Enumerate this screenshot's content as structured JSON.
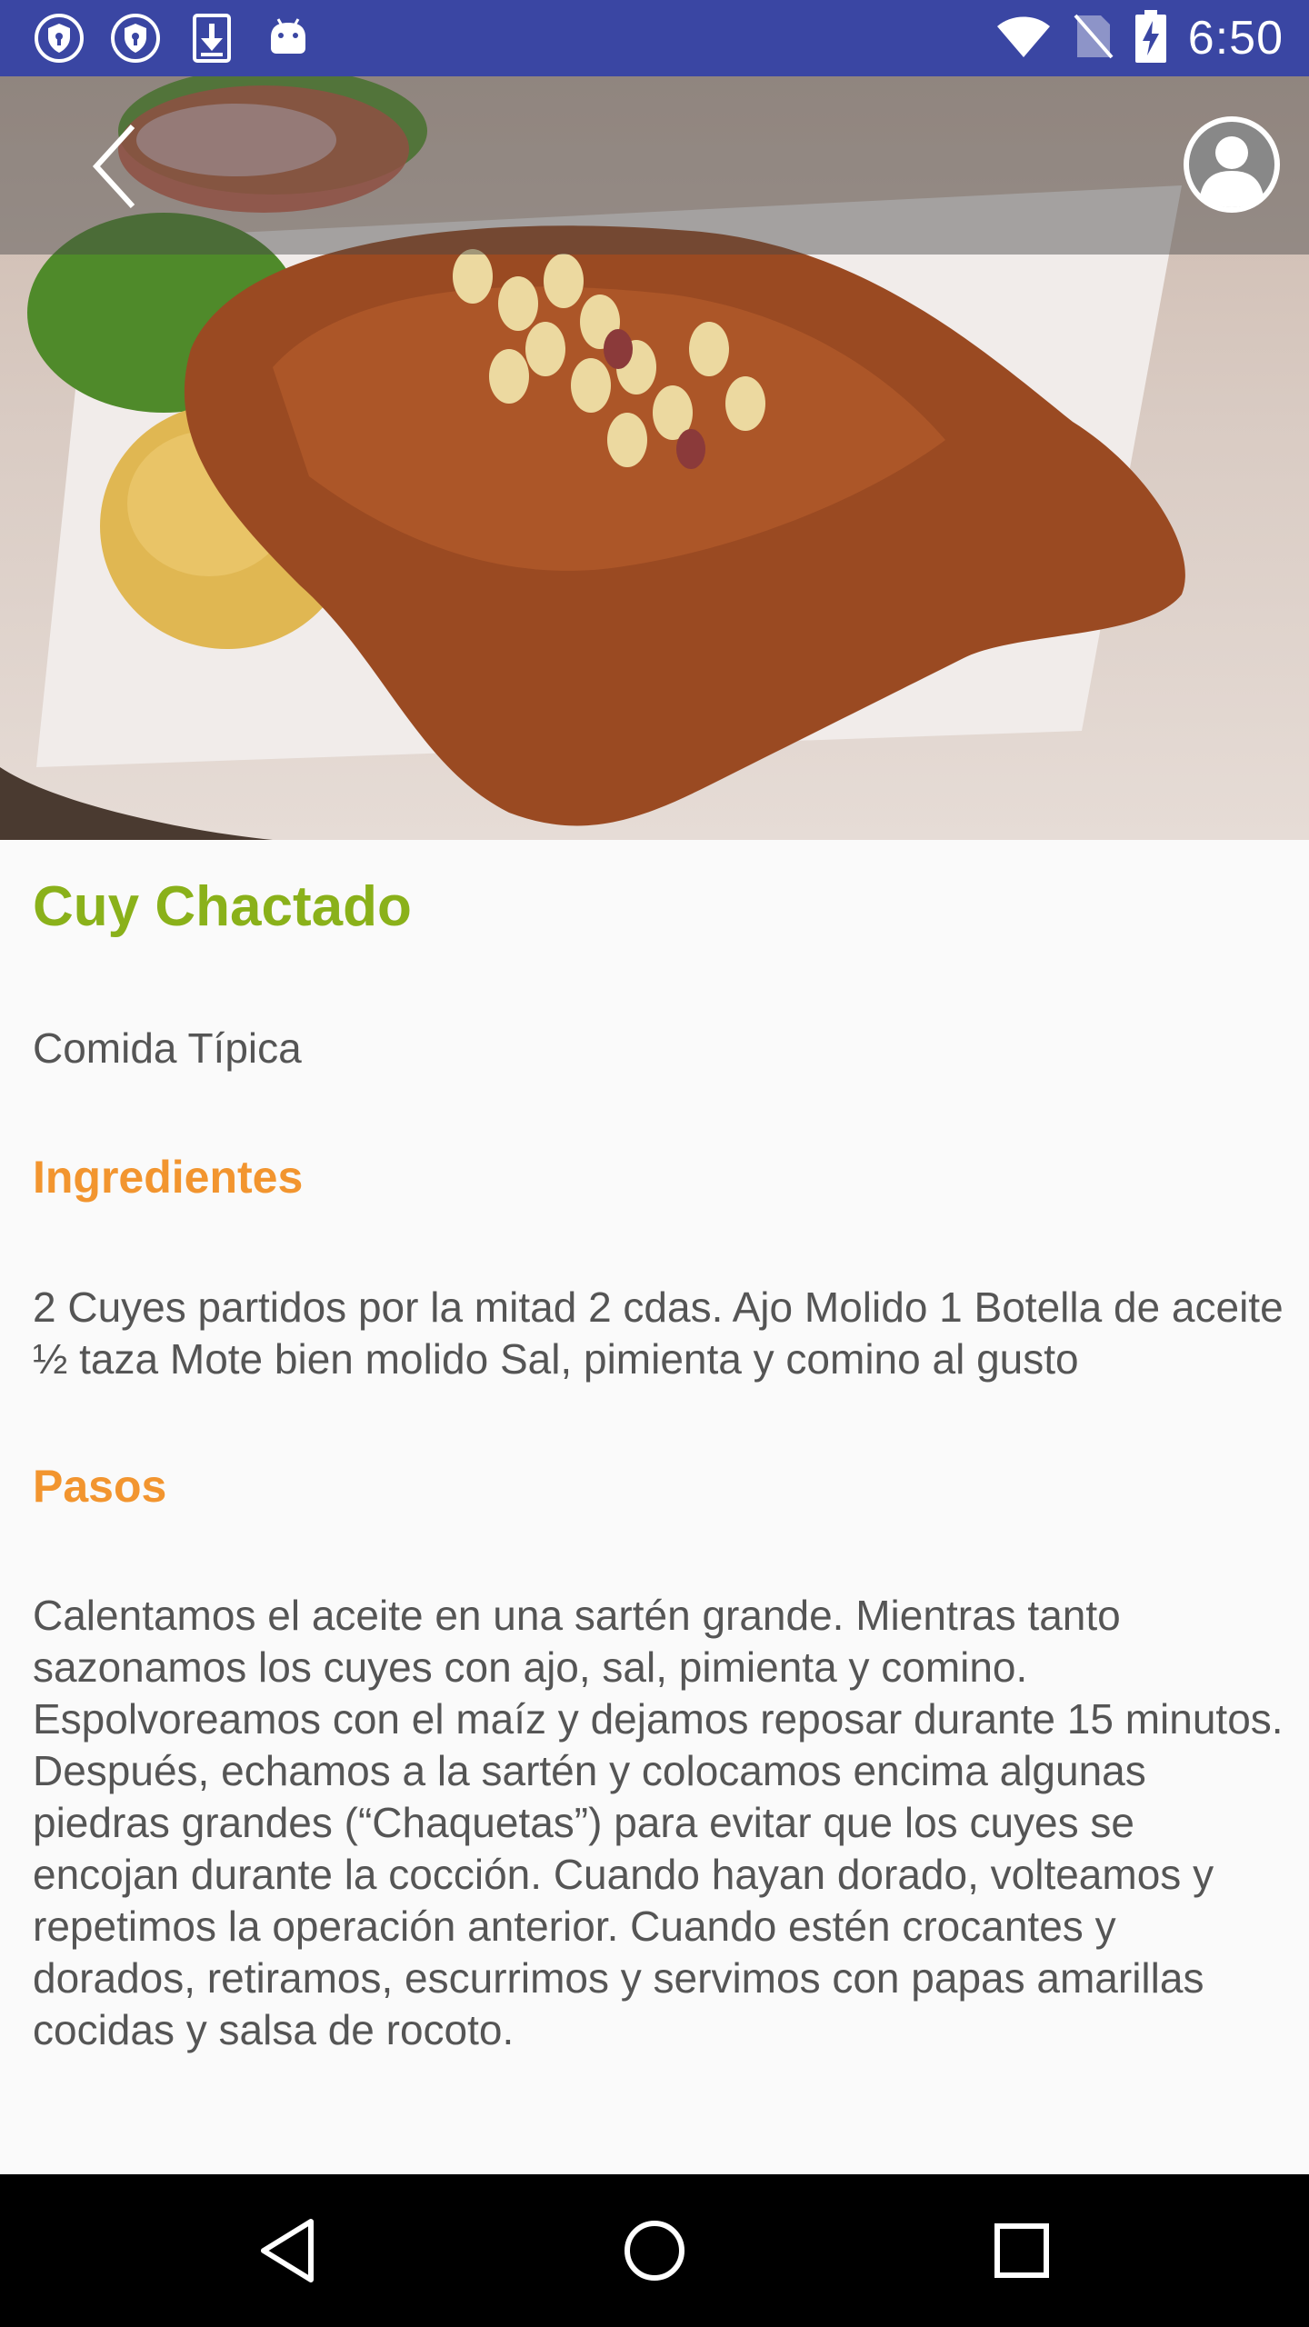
{
  "status_bar": {
    "time": "6:50",
    "left_icons": [
      "shield-notification-icon",
      "shield-notification-icon",
      "download-icon",
      "android-icon"
    ],
    "right_icons": [
      "wifi-icon",
      "no-sim-icon",
      "battery-charging-icon"
    ],
    "background": "#3a46a3"
  },
  "header": {
    "back_icon": "chevron-left-icon",
    "profile_icon": "user-avatar-icon"
  },
  "recipe": {
    "title": "Cuy Chactado",
    "category": "Comida Típica",
    "ingredients_heading": "Ingredientes",
    "ingredients": "2 Cuyes partidos por la mitad 2 cdas. Ajo Molido 1 Botella de aceite ½ taza Mote bien molido Sal, pimienta y comino al gusto",
    "steps_heading": "Pasos",
    "steps": "Calentamos el aceite en una sartén grande. Mientras tanto sazonamos los cuyes con ajo, sal, pimienta y comino. Espolvoreamos con el maíz y dejamos reposar durante 15 minutos. Después, echamos a la sartén y colocamos encima algunas piedras grandes (“Chaquetas”) para evitar que los cuyes se encojan durante la cocción. Cuando hayan dorado, volteamos y repetimos la operación anterior. Cuando estén crocantes y dorados, retiramos, escurrimos y servimos con papas amarillas cocidas y salsa de rocoto."
  },
  "colors": {
    "title": "#8ab11a",
    "section_heading": "#f2952f",
    "body_text": "#555555"
  },
  "nav_bar": {
    "icons": [
      "back-triangle-icon",
      "home-circle-icon",
      "recents-square-icon"
    ]
  }
}
